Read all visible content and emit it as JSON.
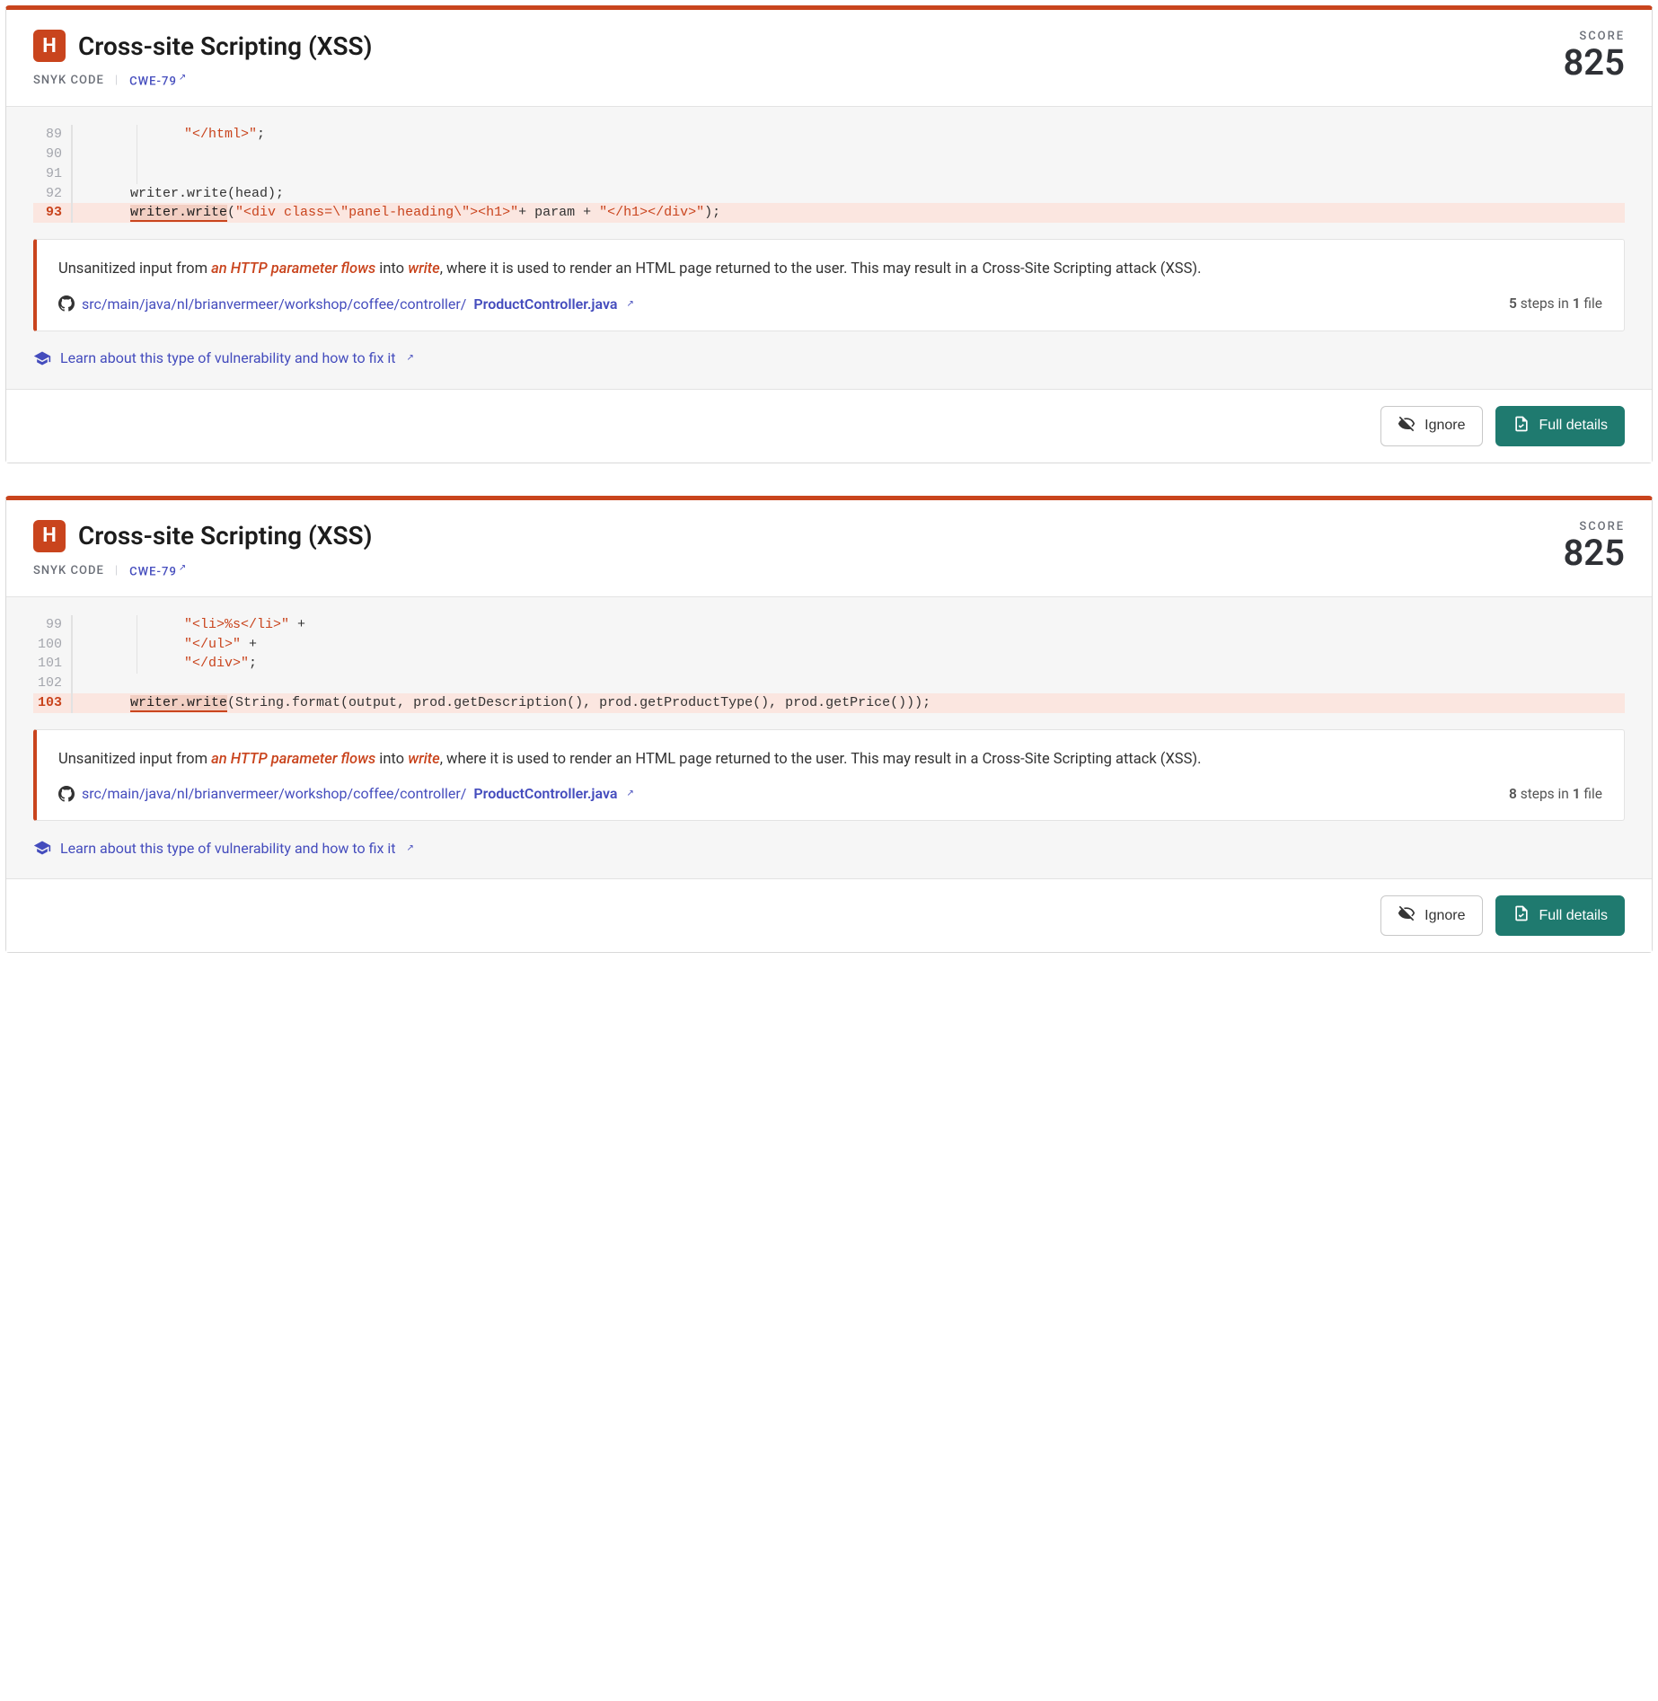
{
  "cards": [
    {
      "severity_letter": "H",
      "title": "Cross-site Scripting (XSS)",
      "source_label": "SNYK CODE",
      "cwe": "CWE-79",
      "score_label": "SCORE",
      "score_value": "825",
      "code_lines": [
        {
          "num": "89",
          "hl": false,
          "indent": true,
          "tokens": [
            [
              "str",
              "\"</html>\""
            ],
            [
              "p",
              ";"
            ]
          ]
        },
        {
          "num": "90",
          "hl": false,
          "indent": true,
          "tokens": []
        },
        {
          "num": "91",
          "hl": false,
          "indent": true,
          "tokens": []
        },
        {
          "num": "92",
          "hl": false,
          "indent": false,
          "tokens": [
            [
              "d",
              "writer.write(head);"
            ]
          ]
        },
        {
          "num": "93",
          "hl": true,
          "indent": false,
          "tokens": [
            [
              "hl",
              "writer.write"
            ],
            [
              "d",
              "("
            ],
            [
              "str",
              "\"<div class=\\\"panel-heading\\\"><h1>\""
            ],
            [
              "d",
              "+ param + "
            ],
            [
              "str",
              "\"</h1></div>\""
            ],
            [
              "d",
              ");"
            ]
          ]
        }
      ],
      "explain": {
        "pre": "Unsanitized input from ",
        "kw1": "an HTTP parameter flows",
        "mid1": " into ",
        "kw2": "write",
        "post": ", where it is used to render an HTML page returned to the user. This may result in a Cross-Site Scripting attack (XSS)."
      },
      "file_path_prefix": "src/main/java/nl/brianvermeer/workshop/coffee/controller/",
      "file_name": "ProductController.java",
      "steps_count": "5",
      "files_count": "1",
      "steps_tpl": {
        "a": " steps in ",
        "b": " file"
      },
      "learn_label": "Learn about this type of vulnerability and how to fix it",
      "btn_ignore": "Ignore",
      "btn_details": "Full details"
    },
    {
      "severity_letter": "H",
      "title": "Cross-site Scripting (XSS)",
      "source_label": "SNYK CODE",
      "cwe": "CWE-79",
      "score_label": "SCORE",
      "score_value": "825",
      "code_lines": [
        {
          "num": "99",
          "hl": false,
          "indent": true,
          "tokens": [
            [
              "str",
              "\"<li>%s</li>\""
            ],
            [
              "d",
              " + "
            ]
          ]
        },
        {
          "num": "100",
          "hl": false,
          "indent": true,
          "tokens": [
            [
              "str",
              "\"</ul>\""
            ],
            [
              "d",
              " + "
            ]
          ]
        },
        {
          "num": "101",
          "hl": false,
          "indent": true,
          "tokens": [
            [
              "str",
              "\"</div>\""
            ],
            [
              "d",
              ";"
            ]
          ]
        },
        {
          "num": "102",
          "hl": false,
          "indent": false,
          "tokens": []
        },
        {
          "num": "103",
          "hl": true,
          "indent": false,
          "tokens": [
            [
              "hl",
              "writer.write"
            ],
            [
              "d",
              "(String.format(output, prod.getDescription(), prod.getProductType(), prod.getPrice()));"
            ]
          ]
        }
      ],
      "explain": {
        "pre": "Unsanitized input from ",
        "kw1": "an HTTP parameter flows",
        "mid1": " into ",
        "kw2": "write",
        "post": ", where it is used to render an HTML page returned to the user. This may result in a Cross-Site Scripting attack (XSS)."
      },
      "file_path_prefix": "src/main/java/nl/brianvermeer/workshop/coffee/controller/",
      "file_name": "ProductController.java",
      "steps_count": "8",
      "files_count": "1",
      "steps_tpl": {
        "a": " steps in ",
        "b": " file"
      },
      "learn_label": "Learn about this type of vulnerability and how to fix it",
      "btn_ignore": "Ignore",
      "btn_details": "Full details"
    }
  ]
}
